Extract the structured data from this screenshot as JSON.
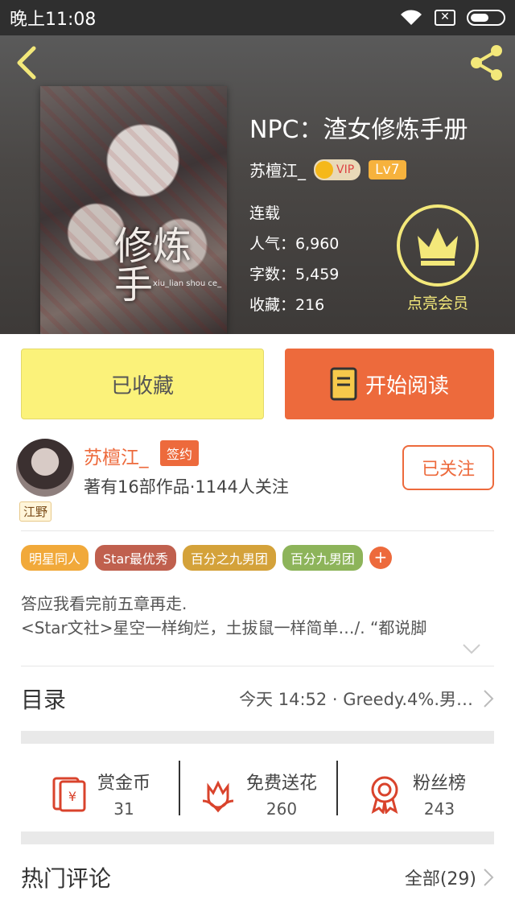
{
  "status_bar": {
    "time": "晚上11:08"
  },
  "book": {
    "title": "NPC：渣女修炼手册",
    "author": "苏檀江_",
    "vip": "VIP",
    "level": "Lv7",
    "status": "连载",
    "popularity": "人气：6,960",
    "word_count": "字数：5,459",
    "favorites": "收藏：216",
    "cover_title": "修炼手",
    "cover_sub": "xiu_lian shou ce_"
  },
  "member": {
    "label": "点亮会员"
  },
  "actions": {
    "collected_label": "已收藏",
    "read_label": "开始阅读"
  },
  "author": {
    "name": "苏檀江_",
    "sign_badge": "签约",
    "avatar_tag": "江野",
    "description": "著有16部作品·1144人关注",
    "follow_label": "已关注"
  },
  "tags": [
    {
      "label": "明星同人",
      "color": "#f1a93a"
    },
    {
      "label": "Star最优秀",
      "color": "#c0604e"
    },
    {
      "label": "百分之九男团",
      "color": "#d4a23a"
    },
    {
      "label": "百分九男团",
      "color": "#8db45a"
    }
  ],
  "tag_add": "+",
  "intro": {
    "line1": "答应我看完前五章再走.",
    "line2": "<Star文社>星空一样绚烂，土拔鼠一样简单…/. “都说脚"
  },
  "toc": {
    "title": "目录",
    "latest": "今天 14:52 · Greedy.4%.男…"
  },
  "rewards": [
    {
      "label": "赏金币",
      "value": "31",
      "icon": "red-envelope-icon"
    },
    {
      "label": "免费送花",
      "value": "260",
      "icon": "flower-icon"
    },
    {
      "label": "粉丝榜",
      "value": "243",
      "icon": "medal-icon"
    }
  ],
  "comments": {
    "title": "热门评论",
    "all": "全部(29)"
  },
  "colors": {
    "accent": "#ed6a3c",
    "collected_bg": "#fbf27a",
    "member_gold": "#f3e87a"
  }
}
